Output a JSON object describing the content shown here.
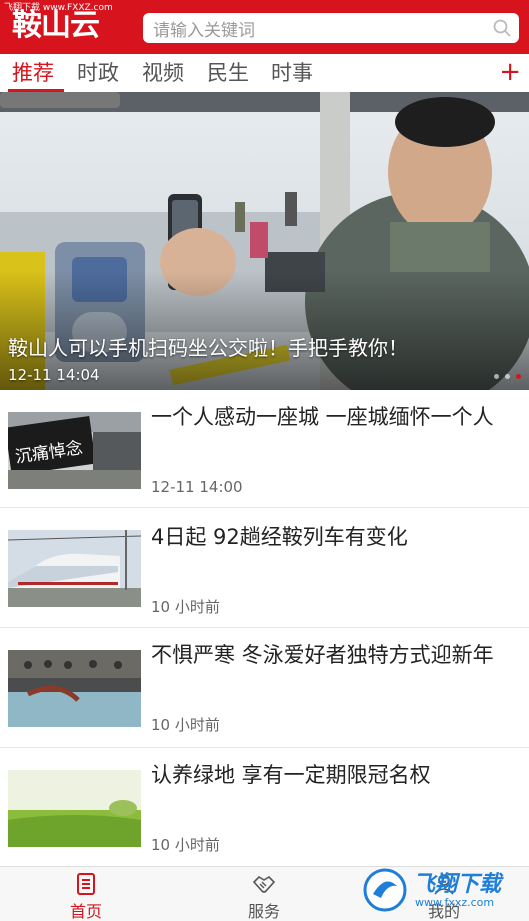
{
  "watermark_top": "飞翔下载 www.FXXZ.com",
  "app": {
    "logo_text": "鞍山云"
  },
  "search": {
    "placeholder": "请输入关键词"
  },
  "tabs": [
    "推荐",
    "时政",
    "视频",
    "民生",
    "时事"
  ],
  "hero": {
    "title": "鞍山人可以手机扫码坐公交啦！手把手教你！",
    "time": "12-11 14:04"
  },
  "news": [
    {
      "title": "一个人感动一座城 一座城缅怀一个人",
      "time": "12-11 14:00"
    },
    {
      "title": "4日起 92趟经鞍列车有变化",
      "time": "10 小时前"
    },
    {
      "title": "不惧严寒 冬泳爱好者独特方式迎新年",
      "time": "10 小时前"
    },
    {
      "title": "认养绿地 享有一定期限冠名权",
      "time": "10 小时前"
    }
  ],
  "banner_text": "沉痛悼念",
  "bottom_nav": [
    {
      "label": "首页",
      "icon": "home-doc-icon"
    },
    {
      "label": "服务",
      "icon": "handshake-icon"
    },
    {
      "label": "我的",
      "icon": "user-icon"
    }
  ],
  "watermark_bottom": {
    "text": "飞翔下载",
    "url": "www.fxxz.com"
  },
  "colors": {
    "brand": "#d7141e"
  }
}
